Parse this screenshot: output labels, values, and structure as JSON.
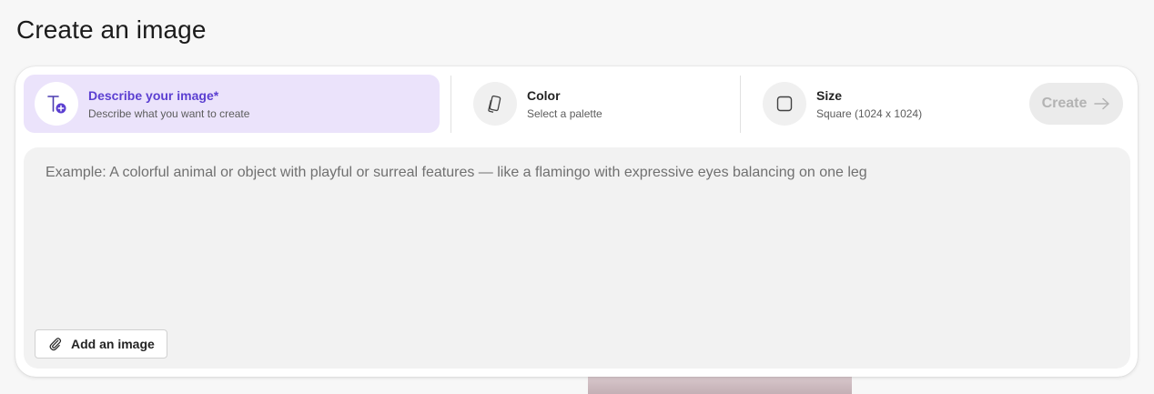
{
  "page": {
    "title": "Create an image"
  },
  "options": {
    "describe": {
      "title": "Describe your image*",
      "subtitle": "Describe what you want to create",
      "icon": "text-add-icon"
    },
    "color": {
      "title": "Color",
      "subtitle": "Select a palette",
      "icon": "palette-swatch-icon"
    },
    "size": {
      "title": "Size",
      "subtitle": "Square (1024 x 1024)",
      "icon": "square-icon"
    }
  },
  "create_button": {
    "label": "Create",
    "icon": "arrow-right-icon",
    "disabled": true
  },
  "prompt": {
    "value": "",
    "placeholder": "Example: A colorful animal or object with playful or surreal features — like a flamingo with expressive eyes balancing on one leg"
  },
  "add_image_button": {
    "label": "Add an image",
    "icon": "paperclip-icon"
  },
  "colors": {
    "accent": "#5b3fd1",
    "selected_option_bg": "#ebe3fb",
    "prompt_bg": "#f2f2f2"
  }
}
